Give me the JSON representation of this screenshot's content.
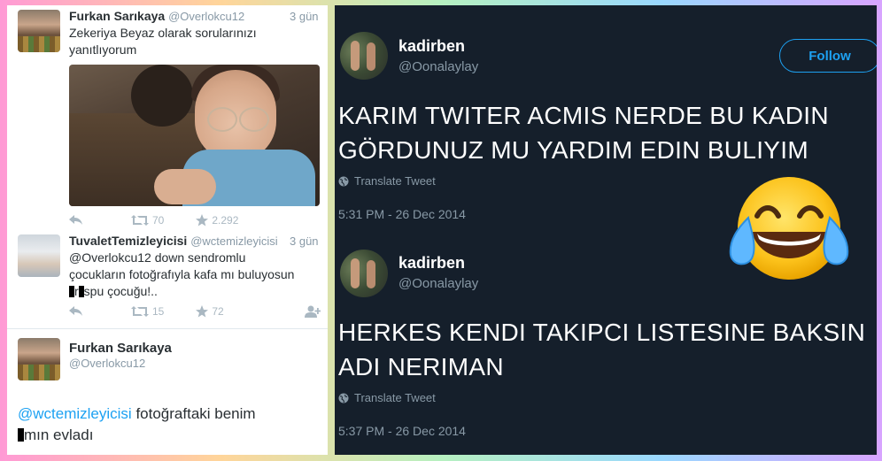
{
  "left": {
    "tweet1": {
      "name": "Furkan Sarıkaya",
      "handle": "@Overlokcu12",
      "time": "3 gün",
      "text": "Zekeriya Beyaz olarak sorularınızı yanıtlıyorum",
      "retweets": "70",
      "likes": "2.292"
    },
    "tweet2": {
      "name": "TuvaletTemizleyicisi",
      "handle": "@wctemizleyicisi",
      "time": "3 gün",
      "line1": "@Overlokcu12 down sendromlu",
      "line2": "çocukların fotoğrafıyla kafa mı buluyosun",
      "line3_a": "",
      "line3_b": "r",
      "line3_c": "spu çocuğu!..",
      "retweets": "15",
      "likes": "72"
    },
    "tweet3": {
      "name": "Furkan Sarıkaya",
      "handle": "@Overlokcu12",
      "mention": "@wctemizleyicisi",
      "text_rest": " fotoğraftaki benim",
      "line2": "mın evladı"
    }
  },
  "right": {
    "tweet1": {
      "name": "kadirben",
      "handle": "@Oonalaylay",
      "follow_label": "Follow",
      "line1": "KARIM TWITER ACMIS NERDE BU KADIN",
      "line2": "GÖRDUNUZ MU YARDIM EDIN BULIYIM",
      "translate": "Translate Tweet",
      "time": "5:31 PM - 26 Dec 2014"
    },
    "tweet2": {
      "name": "kadirben",
      "handle": "@Oonalaylay",
      "line1": "HERKES KENDI TAKIPCI LISTESINE BAKSIN",
      "line2": "ADI NERIMAN",
      "translate": "Translate Tweet",
      "time": "5:37 PM - 26 Dec 2014"
    }
  },
  "icons": {
    "reply": "reply-icon",
    "retweet": "retweet-icon",
    "like": "star-icon",
    "follow_user": "add-user-icon",
    "globe": "globe-icon",
    "emoji": "tears-of-joy-emoji"
  },
  "colors": {
    "link_blue": "#1da1f2",
    "dark_bg": "#151f2b",
    "muted": "#8899a6"
  }
}
